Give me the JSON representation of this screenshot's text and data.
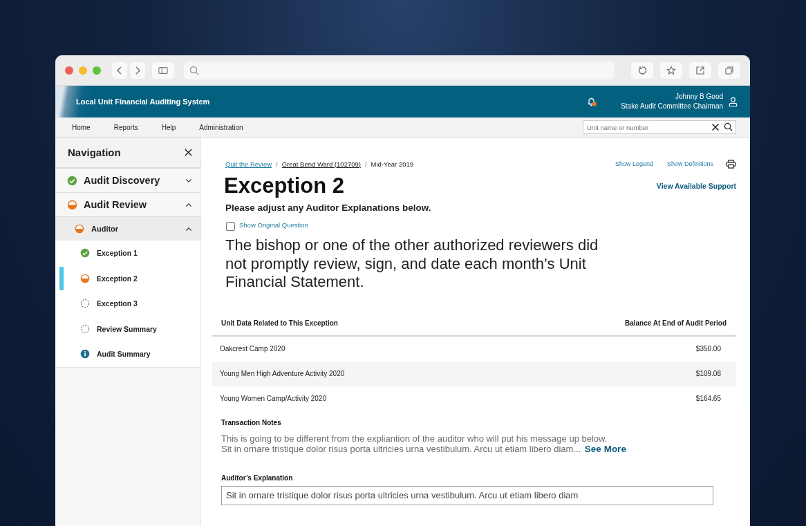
{
  "header": {
    "app_title": "Local Unit Financial Auditing System",
    "notifications": true,
    "user_name": "Johnny B Good",
    "user_role": "Stake Audit Committee Chairman"
  },
  "menu": [
    {
      "label": "Home"
    },
    {
      "label": "Reports"
    },
    {
      "label": "Help"
    },
    {
      "label": "Administration"
    }
  ],
  "search": {
    "placeholder": "Unit name or number"
  },
  "navigation": {
    "title": "Navigation",
    "sections": [
      {
        "label": "Audit Discovery",
        "kind": "complete",
        "expanded": false
      },
      {
        "label": "Audit Review",
        "kind": "partial",
        "expanded": true,
        "children": [
          {
            "label": "Auditor",
            "kind": "partial",
            "expanded": true,
            "children": [
              {
                "label": "Exception 1",
                "kind": "complete",
                "selected": false
              },
              {
                "label": "Exception 2",
                "kind": "partial",
                "selected": true
              },
              {
                "label": "Exception 3",
                "kind": "pending",
                "selected": false
              },
              {
                "label": "Review Summary",
                "kind": "pending",
                "selected": false
              },
              {
                "label": "Audit Summary",
                "kind": "info",
                "selected": false
              }
            ]
          }
        ]
      }
    ]
  },
  "breadcrumb": [
    {
      "label": "Quit the Review",
      "kind": "link"
    },
    {
      "label": "/",
      "kind": "separator"
    },
    {
      "label": "Great Bend Ward (102709)",
      "kind": "ward"
    },
    {
      "label": "/",
      "kind": "separator"
    },
    {
      "label": "Mid-Year 2019",
      "kind": "current"
    }
  ],
  "page_actions": [
    {
      "label": "Show Legend"
    },
    {
      "label": "Show Definitions"
    }
  ],
  "title": "Exception 2",
  "support_link": "View Available Support",
  "instruction": "Please adjust any Auditor Explanations below.",
  "show_original": {
    "label": "Show Original Question",
    "checked": false
  },
  "question": "The bishop or one of the other authorized reviewers did not promptly review, sign, and date each month’s Unit Financial Statement.",
  "table": {
    "columns": [
      "Unit Data Related to This Exception",
      "Balance At End of Audit Period"
    ],
    "rows": [
      [
        "Oakcrest Camp 2020",
        "$350.00"
      ],
      [
        "Young Men High Adventure Activity 2020",
        "$109.08"
      ],
      [
        "Young Women Camp/Activity 2020",
        "$164.65"
      ]
    ]
  },
  "transaction_notes": {
    "heading": "Transaction Notes",
    "lines": [
      "This is going to be different from the expliantion of the auditor who will put his message up below.",
      "Sit in ornare tristique dolor risus porta ultricies urna vestibulum. Arcu ut etiam libero diam..."
    ],
    "see_more": "See More"
  },
  "auditor_explanation": {
    "heading": "Auditor’s Explanation",
    "value": "Sit in ornare tristique dolor risus porta ultricies urna vestibulum. Arcu ut etiam libero diam"
  }
}
